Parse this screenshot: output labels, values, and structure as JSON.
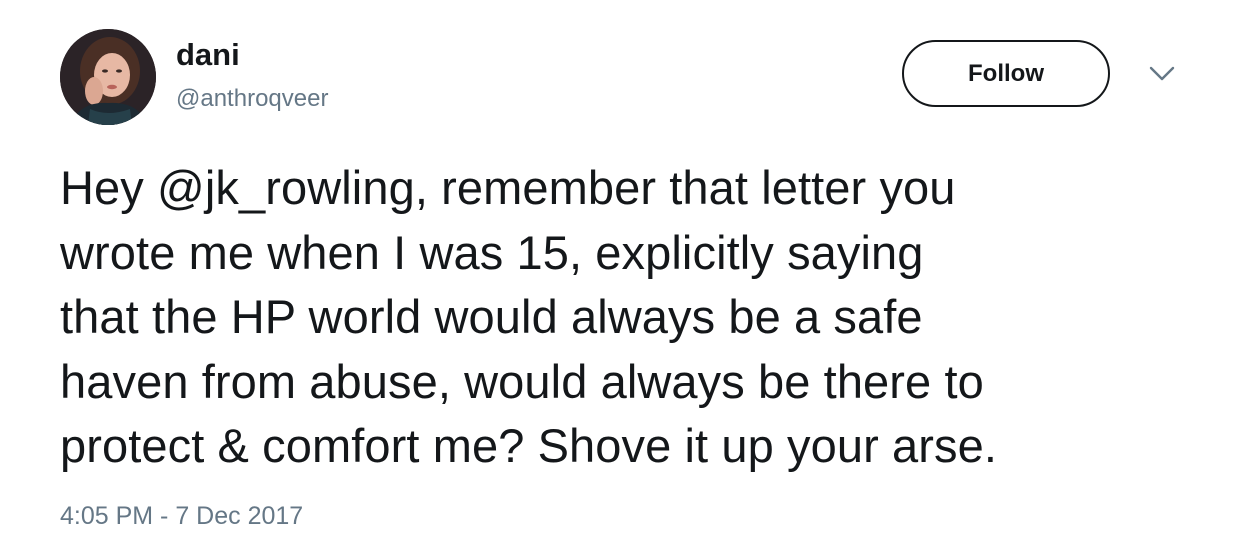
{
  "tweet": {
    "author": {
      "display_name": "dani",
      "handle": "@anthroqveer"
    },
    "follow_label": "Follow",
    "text": "Hey @jk_rowling, remember that letter you\nwrote me when I was 15, explicitly saying\nthat the HP world would always be a safe\nhaven from abuse, would always be there to\nprotect & comfort me? Shove it up your arse.",
    "timestamp": "4:05 PM - 7 Dec 2017"
  },
  "icons": {
    "menu": "chevron-down-icon",
    "avatar": "avatar"
  },
  "colors": {
    "text_primary": "#14171a",
    "text_secondary": "#657786",
    "background": "#ffffff"
  }
}
